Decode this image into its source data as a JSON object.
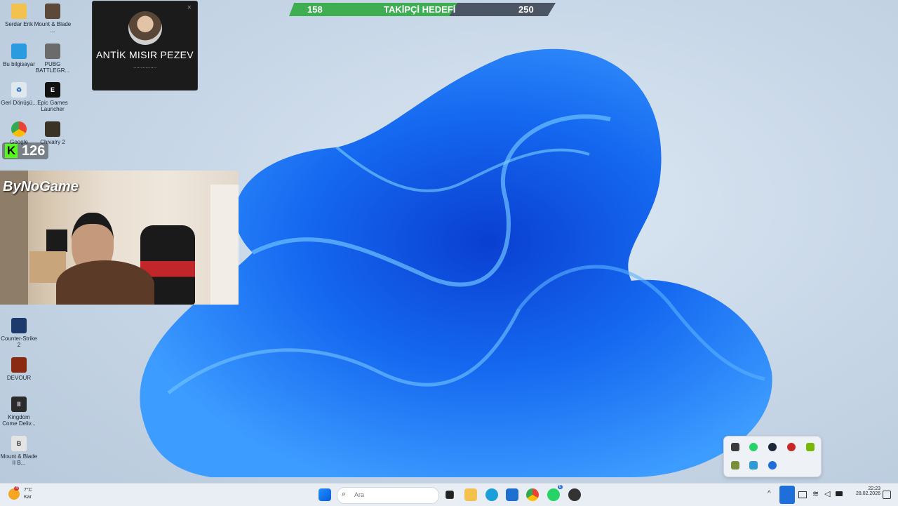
{
  "desktop_icons": [
    {
      "label": "Serdar Erik"
    },
    {
      "label": "Mount & Blade ..."
    },
    {
      "label": "Bu bilgisayar"
    },
    {
      "label": "PUBG BATTLEGR..."
    },
    {
      "label": "Geri Dönüşü..."
    },
    {
      "label": "Epic Games Launcher"
    },
    {
      "label": "Google"
    },
    {
      "label": "Chivalry 2"
    },
    {
      "label": "Counter-Strike 2"
    },
    {
      "label": "DEVOUR"
    },
    {
      "label": "Kingdom Come Deliv..."
    },
    {
      "label": "Mount & Blade II B..."
    }
  ],
  "follower_goal": {
    "current": "158",
    "label": "TAKİPÇİ HEDEFİ",
    "target": "250",
    "progress": 0.632,
    "fill_color": "#3fae52"
  },
  "notification": {
    "name": "ANTİK MISIR PEZEV",
    "subtitle": "..............."
  },
  "kick": {
    "count": "126",
    "brand_color": "#53fc18"
  },
  "webcam": {
    "overlay_logo_text": "ByNoGame"
  },
  "taskbar": {
    "weather": {
      "temp": "7°C",
      "condition": "Kar",
      "badge": "4"
    },
    "search_placeholder": "Ara",
    "clock_time": "22:23",
    "clock_date": "28.02.2026",
    "whatsapp_badge": "6"
  }
}
